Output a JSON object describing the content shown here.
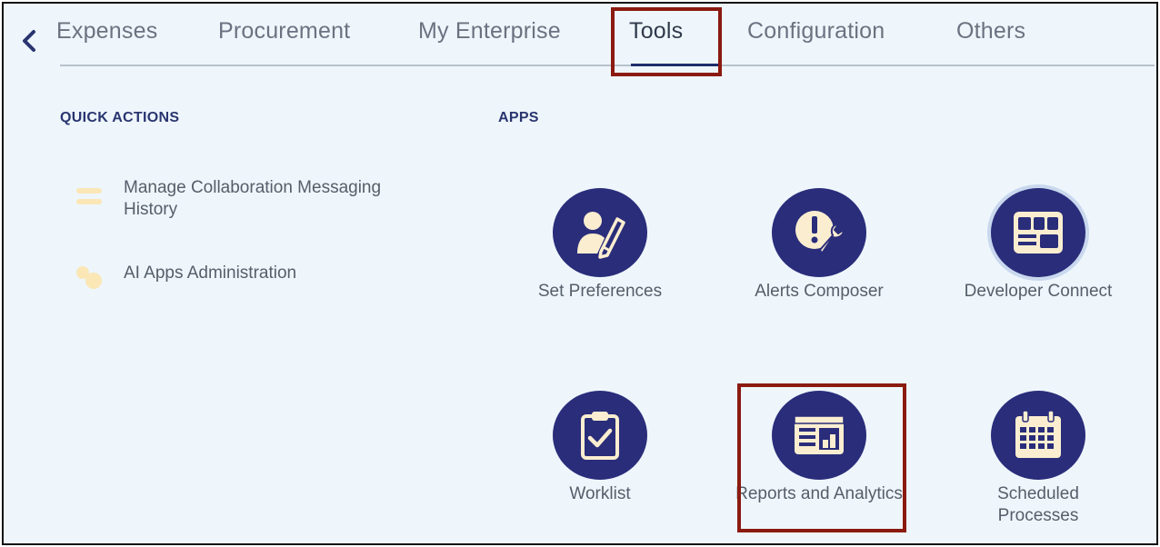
{
  "nav": {
    "tabs": [
      {
        "label": "Expenses"
      },
      {
        "label": "Procurement"
      },
      {
        "label": "My Enterprise"
      },
      {
        "label": "Tools"
      },
      {
        "label": "Configuration"
      },
      {
        "label": "Others"
      }
    ],
    "active_tab": "Tools"
  },
  "quick_actions": {
    "title": "QUICK ACTIONS",
    "items": [
      {
        "label": "Manage Collaboration Messaging History",
        "icon": "arrows-exchange-icon"
      },
      {
        "label": "AI Apps Administration",
        "icon": "gears-icon"
      }
    ]
  },
  "apps": {
    "title": "APPS",
    "items": [
      {
        "label": "Set Preferences",
        "icon": "user-pencil-icon"
      },
      {
        "label": "Alerts Composer",
        "icon": "alert-wrench-icon"
      },
      {
        "label": "Developer Connect",
        "icon": "dashboard-window-icon"
      },
      {
        "label": "Worklist",
        "icon": "clipboard-check-icon"
      },
      {
        "label": "Reports and Analytics",
        "icon": "report-chart-icon"
      },
      {
        "label": "Scheduled Processes",
        "icon": "calendar-icon"
      }
    ]
  },
  "colors": {
    "background": "#eef6fc",
    "app_icon": "#2a2d7a",
    "icon_fill": "#fbeed0",
    "highlight": "#8b1a10",
    "section_title": "#2a3570"
  }
}
